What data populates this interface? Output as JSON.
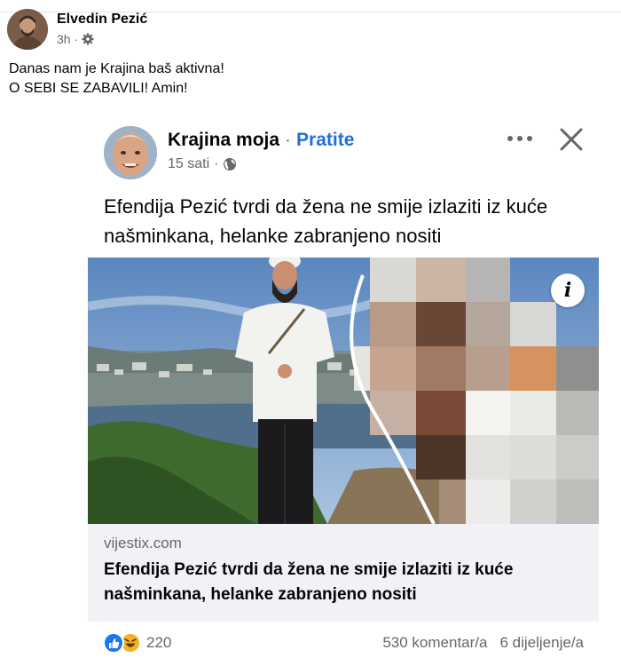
{
  "post": {
    "author": "Elvedin Pezić",
    "time": "3h",
    "text_line1": "Danas nam je Krajina baš aktivna!",
    "text_line2": "O SEBI SE ZABAVILI! Amin!"
  },
  "shared_post": {
    "page_name": "Krajina moja",
    "follow_label": "Pratite",
    "time": "15 sati",
    "text": "Efendija Pezić tvrdi da žena ne smije izlaziti iz kuće našminkana, helanke zabranjeno nositi",
    "info_icon_label": "i"
  },
  "link_preview": {
    "domain": "vijestix.com",
    "title": "Efendija Pezić tvrdi da žena ne smije izlaziti iz kuće našminkana, helanke zabranjeno nositi"
  },
  "engagement": {
    "reactions_count": "220",
    "comments": "530 komentar/a",
    "shares": "6 dijeljenje/a"
  },
  "icons": {
    "privacy_outer": "gear-icon",
    "privacy_inner": "globe-icon",
    "reaction_1": "like-icon",
    "reaction_2": "haha-icon"
  },
  "colors": {
    "accent": "#216fdb",
    "secondary_text": "#65676b",
    "preview_bg": "#f0f2f5"
  }
}
